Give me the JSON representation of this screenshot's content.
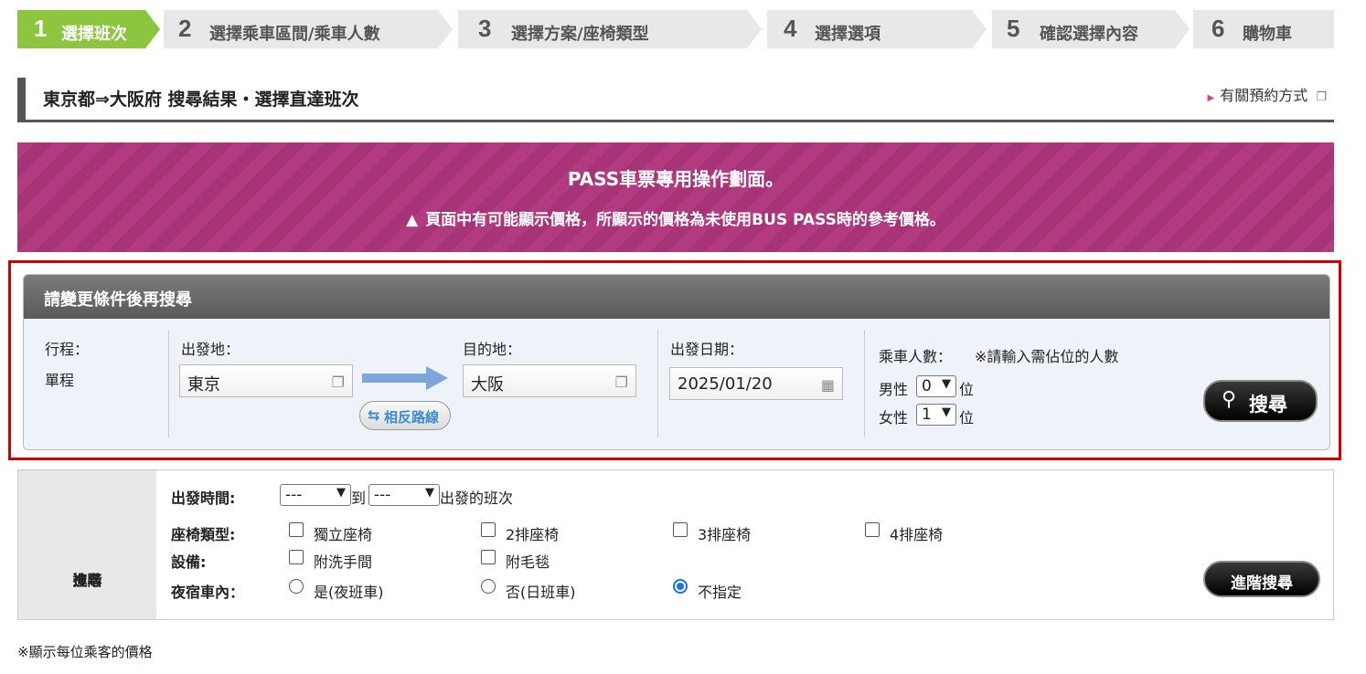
{
  "steps": [
    {
      "num": "1",
      "label": "選擇班次"
    },
    {
      "num": "2",
      "label": "選擇乘車區間/乘車人數"
    },
    {
      "num": "3",
      "label": "選擇方案/座椅類型"
    },
    {
      "num": "4",
      "label": "選擇選項"
    },
    {
      "num": "5",
      "label": "確認選擇內容"
    },
    {
      "num": "6",
      "label": "購物車"
    }
  ],
  "heading": {
    "title": "東京都⇒大阪府  搜尋結果・選擇直達班次",
    "howto": "有關預約方式"
  },
  "pass": {
    "line1": "PASS車票專用操作劃面。",
    "line2": "頁面中有可能顯示價格，所顯示的價格為未使用BUS PASS時的參考價格。"
  },
  "search": {
    "header": "請變更條件後再搜尋",
    "trip_label": "行程：",
    "trip_value": "單程",
    "origin_label": "出發地：",
    "origin_value": "東京",
    "dest_label": "目的地：",
    "dest_value": "大阪",
    "reverse_label": "相反路線",
    "date_label": "出發日期：",
    "date_value": "2025/01/20",
    "pax_label": "乘車人數：",
    "pax_note": "※請輸入需佔位的人數",
    "male_label": "男性",
    "male_value": "0",
    "female_label": "女性",
    "female_value": "1",
    "unit": "位",
    "search_button": "搜尋"
  },
  "advanced": {
    "side_label_1": "進階",
    "side_label_2": "搜尋",
    "time_label": "出發時間:",
    "time_from": "---",
    "time_to_word": "到",
    "time_to": "---",
    "time_suffix": "出發的班次",
    "seat_label": "座椅類型:",
    "seat_options": [
      "獨立座椅",
      "2排座椅",
      "3排座椅",
      "4排座椅"
    ],
    "facility_label": "設備:",
    "facility_options": [
      "附洗手間",
      "附毛毯"
    ],
    "overnight_label": "夜宿車內：",
    "overnight_options": [
      "是(夜班車)",
      "否(日班車)",
      "不指定"
    ],
    "overnight_selected": "不指定",
    "button": "進階搜尋"
  },
  "footnote": "※顯示每位乘客的價格",
  "colors": {
    "step_active": "#8cc63f",
    "pass_banner": "#b23a80",
    "highlight_frame": "#d40000",
    "radio_selected": "#1a73e8"
  }
}
